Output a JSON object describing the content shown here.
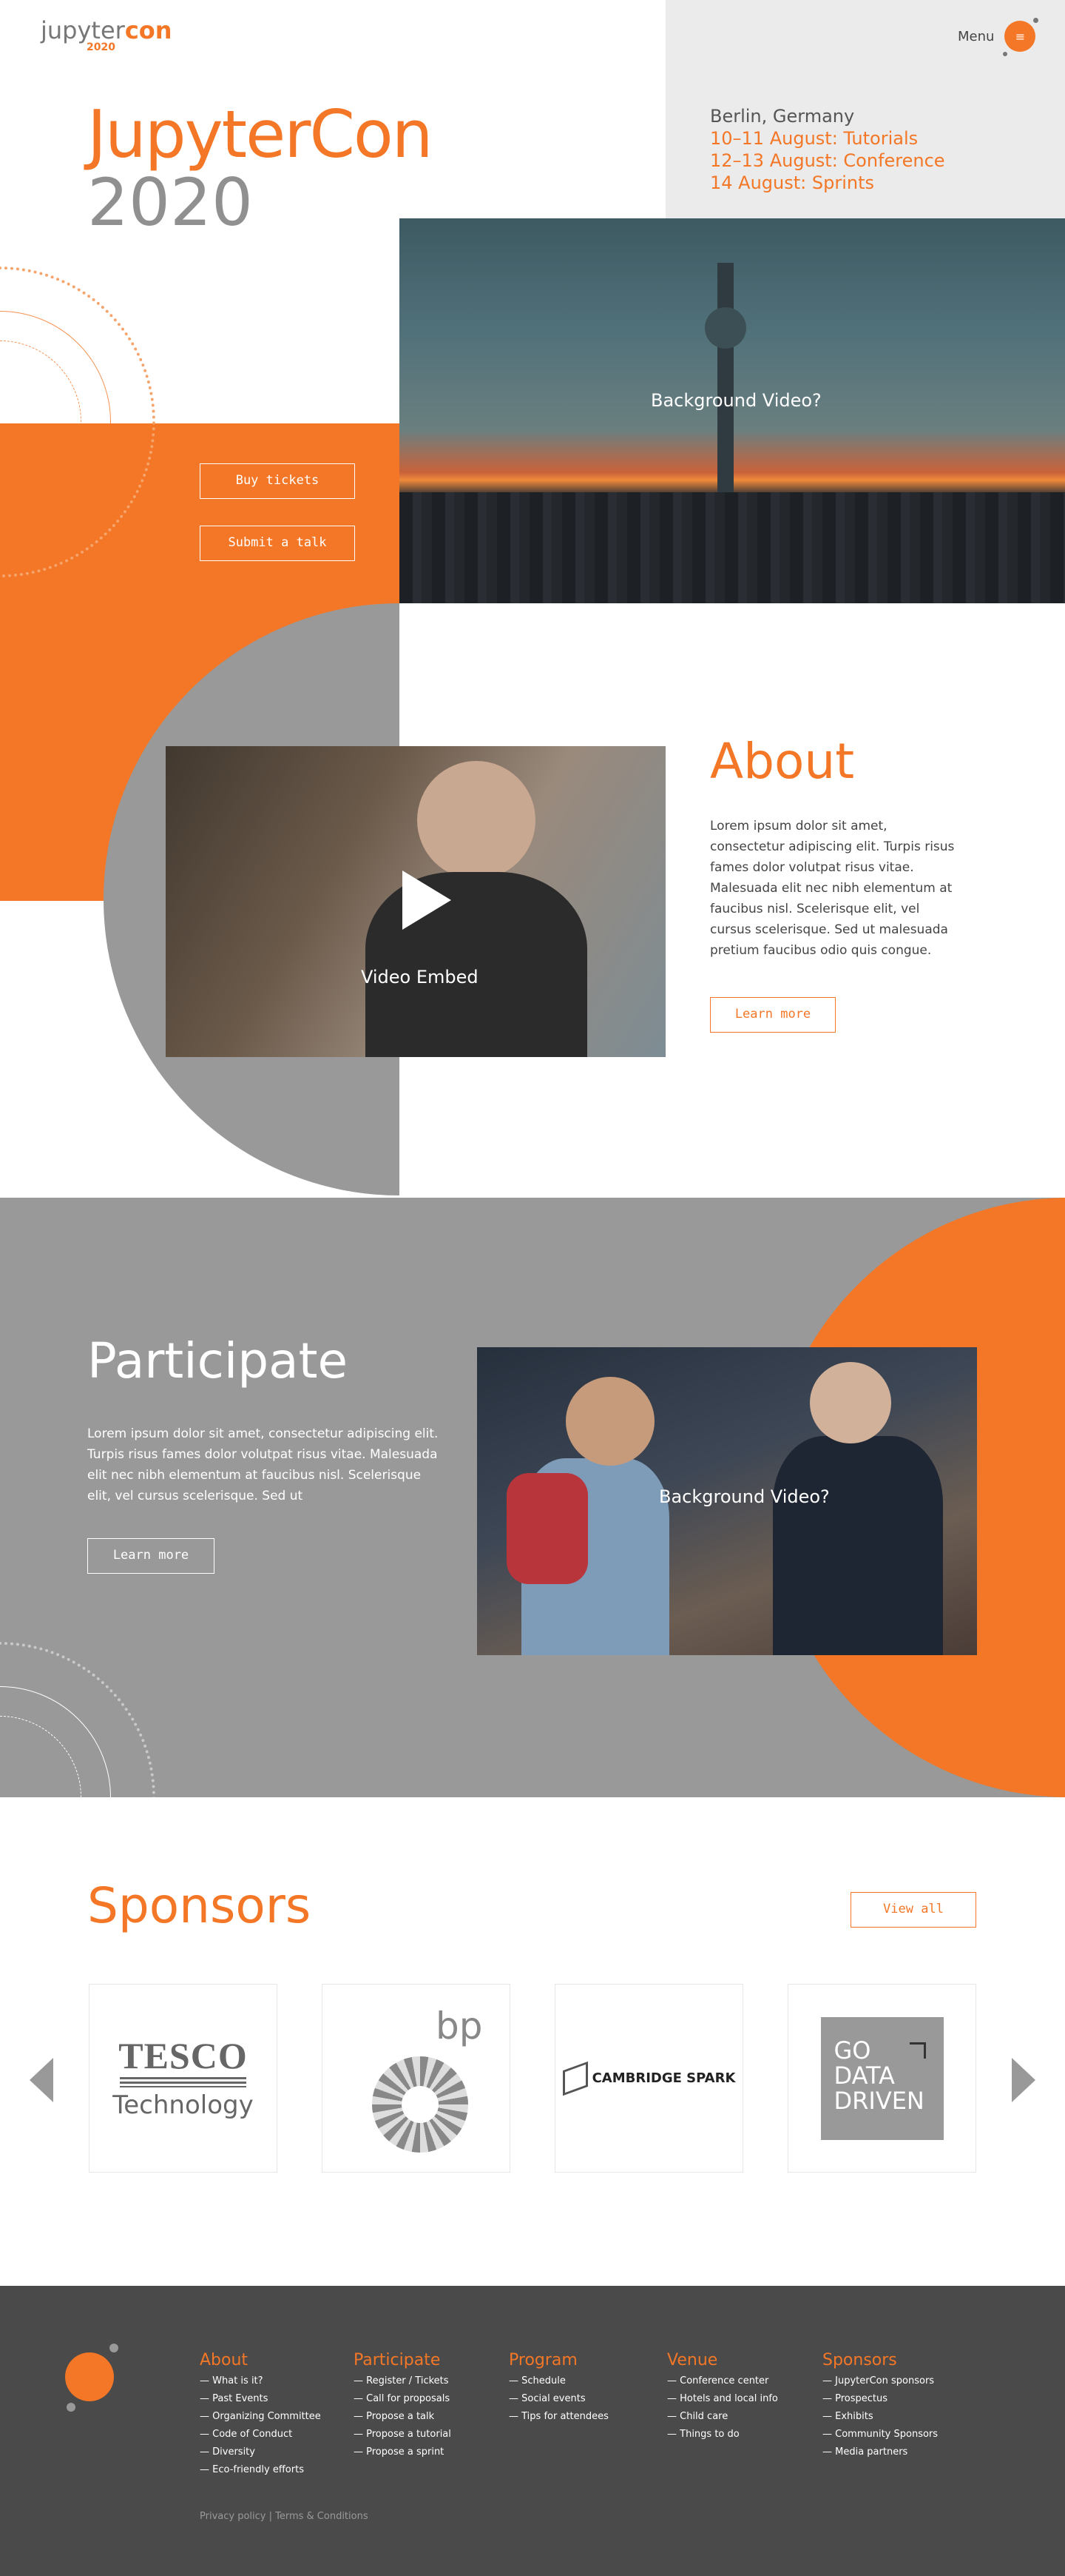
{
  "brand": {
    "logo_text_a": "jupyter",
    "logo_text_b": "con",
    "logo_year": "2020"
  },
  "nav": {
    "menu_label": "Menu",
    "menu_icon": "hamburger-icon"
  },
  "hero": {
    "title": "JupyterCon",
    "year": "2020",
    "location": "Berlin, Germany",
    "dates": [
      "10–11 August: Tutorials",
      "12–13 August: Conference",
      "14 August: Sprints"
    ],
    "video_label": "Background Video?",
    "buy_label": "Buy tickets",
    "talk_label": "Submit a talk"
  },
  "about": {
    "title": "About",
    "text": "Lorem ipsum dolor sit amet, consectetur adipiscing elit. Turpis risus fames dolor volutpat risus vitae. Malesuada elit nec nibh elementum at faucibus nisl. Scelerisque elit, vel cursus scelerisque. Sed ut malesuada pretium faucibus odio quis congue.",
    "video_label": "Video Embed",
    "button": "Learn more"
  },
  "participate": {
    "title": "Participate",
    "text": "Lorem ipsum dolor sit amet, consectetur adipiscing elit. Turpis risus fames dolor volutpat risus vitae. Malesuada elit nec nibh elementum at faucibus nisl. Scelerisque elit, vel cursus scelerisque. Sed ut",
    "button": "Learn more",
    "video_label": "Background Video?"
  },
  "sponsors": {
    "title": "Sponsors",
    "view_all": "View all",
    "tesco_a": "TESCO",
    "tesco_b": "Technology",
    "bp": "bp",
    "cambridge": "CAMBRIDGE SPARK",
    "gdd": [
      "GO",
      "DATA",
      "DRIVEN"
    ]
  },
  "footer": {
    "cols": [
      {
        "h": "About",
        "items": [
          "— What is it?",
          "— Past Events",
          "— Organizing Committee",
          "— Code of Conduct",
          "— Diversity",
          "— Eco-friendly efforts"
        ]
      },
      {
        "h": "Participate",
        "items": [
          "— Register / Tickets",
          "— Call for proposals",
          "— Propose a talk",
          "— Propose a tutorial",
          "— Propose a sprint"
        ]
      },
      {
        "h": "Program",
        "items": [
          "— Schedule",
          "— Social events",
          "— Tips for attendees"
        ]
      },
      {
        "h": "Venue",
        "items": [
          "— Conference center",
          "— Hotels and local info",
          "— Child care",
          "— Things to do"
        ]
      },
      {
        "h": "Sponsors",
        "items": [
          "— JupyterCon sponsors",
          "— Prospectus",
          "— Exhibits",
          "— Community Sponsors",
          "— Media partners"
        ]
      }
    ],
    "legal": "Privacy policy | Terms & Conditions"
  },
  "colors": {
    "accent": "#f37726",
    "grey": "#999999",
    "footer": "#4a4a4a"
  }
}
